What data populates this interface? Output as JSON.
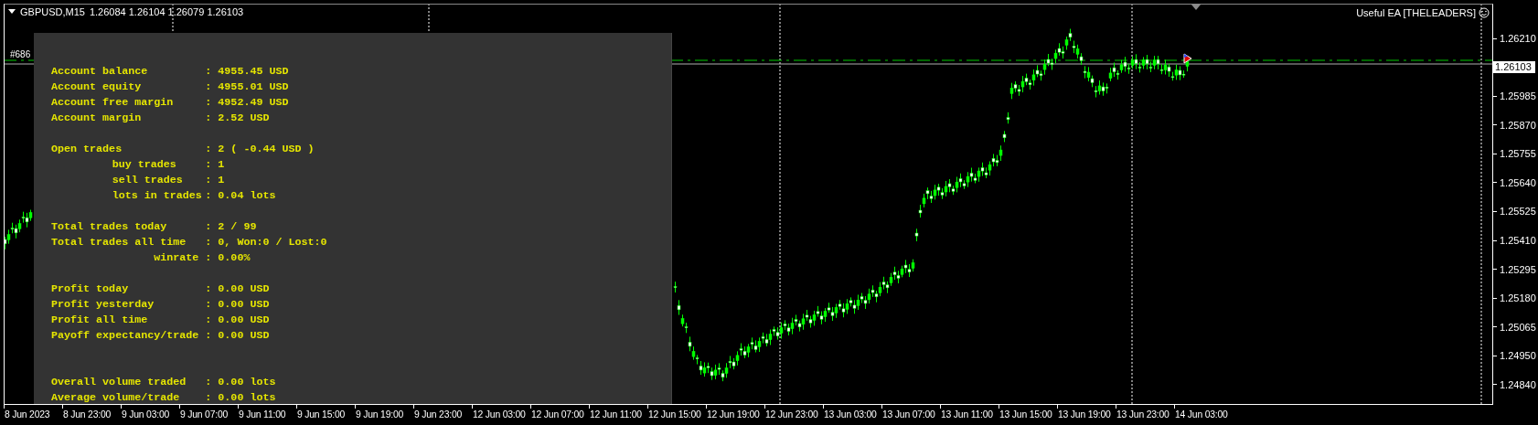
{
  "chart_header": {
    "symbol": "GBPUSD,M15",
    "quotes": "1.26084 1.26104 1.26079 1.26103"
  },
  "expert_label": "Useful EA [THELEADERS]",
  "object_label": "#686",
  "info_panel": {
    "groups": [
      {
        "lines": [
          {
            "kind": "main",
            "label": "Account balance",
            "value": ": 4955.45 USD"
          },
          {
            "kind": "main",
            "label": "Account equity",
            "value": ": 4955.01 USD"
          },
          {
            "kind": "main",
            "label": "Account free margin",
            "value": ": 4952.49 USD"
          },
          {
            "kind": "main",
            "label": "Account margin",
            "value": ": 2.52 USD"
          }
        ]
      },
      {
        "lines": [
          {
            "kind": "main",
            "label": "Open trades",
            "value": ": 2 ( -0.44 USD )"
          },
          {
            "kind": "sub",
            "label": "buy trades",
            "value": ": 1"
          },
          {
            "kind": "sub",
            "label": "sell trades",
            "value": ": 1"
          },
          {
            "kind": "sub",
            "label": "lots in trades",
            "value": ": 0.04 lots"
          }
        ]
      },
      {
        "lines": [
          {
            "kind": "main",
            "label": "Total trades today",
            "value": ": 2 / 99"
          },
          {
            "kind": "main",
            "label": "Total trades all time",
            "value": ": 0, Won:0 / Lost:0"
          },
          {
            "kind": "rate",
            "label": "winrate",
            "value": ": 0.00%"
          }
        ]
      },
      {
        "lines": [
          {
            "kind": "main",
            "label": "Profit today",
            "value": ": 0.00 USD"
          },
          {
            "kind": "main",
            "label": "Profit yesterday",
            "value": ": 0.00 USD"
          },
          {
            "kind": "main",
            "label": "Profit all time",
            "value": ": 0.00 USD"
          },
          {
            "kind": "main",
            "label": "Payoff expectancy/trade",
            "value": ": 0.00 USD"
          }
        ]
      },
      {
        "lines": [
          {
            "kind": "main",
            "label": "Overall volume traded",
            "value": ": 0.00 lots"
          },
          {
            "kind": "main",
            "label": "Average volume/trade",
            "value": ": 0.00 lots"
          }
        ]
      }
    ]
  },
  "price_axis": {
    "top_label": "1.26210",
    "current_price": "1.26103",
    "labels": [
      "1.25985",
      "1.25870",
      "1.25755",
      "1.25640",
      "1.25525",
      "1.25410",
      "1.25295",
      "1.25180",
      "1.25065",
      "1.24950",
      "1.24840"
    ]
  },
  "time_axis": {
    "labels": [
      "8 Jun 2023",
      "8 Jun 23:00",
      "9 Jun 03:00",
      "9 Jun 07:00",
      "9 Jun 11:00",
      "9 Jun 15:00",
      "9 Jun 19:00",
      "9 Jun 23:00",
      "12 Jun 03:00",
      "12 Jun 07:00",
      "12 Jun 11:00",
      "12 Jun 15:00",
      "12 Jun 19:00",
      "12 Jun 23:00",
      "13 Jun 03:00",
      "13 Jun 07:00",
      "13 Jun 11:00",
      "13 Jun 15:00",
      "13 Jun 19:00",
      "13 Jun 23:00",
      "14 Jun 03:00"
    ]
  }
}
